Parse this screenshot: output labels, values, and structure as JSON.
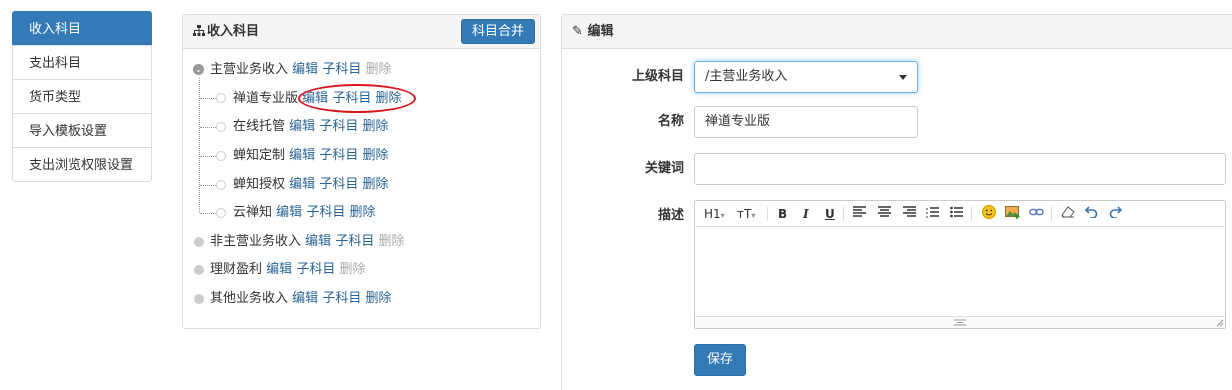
{
  "sidebar": {
    "items": [
      {
        "label": "收入科目",
        "active": true
      },
      {
        "label": "支出科目"
      },
      {
        "label": "货币类型"
      },
      {
        "label": "导入模板设置"
      },
      {
        "label": "支出浏览权限设置"
      }
    ]
  },
  "tree_panel": {
    "title": "收入科目",
    "merge_button": "科目合并",
    "nodes": [
      {
        "name": "主营业务收入",
        "edit": "编辑",
        "child": "子科目",
        "delete": "删除",
        "delete_disabled": true,
        "expanded": true,
        "children": [
          {
            "name": "禅道专业版",
            "edit": "编辑",
            "child": "子科目",
            "delete": "删除"
          },
          {
            "name": "在线托管",
            "edit": "编辑",
            "child": "子科目",
            "delete": "删除"
          },
          {
            "name": "蝉知定制",
            "edit": "编辑",
            "child": "子科目",
            "delete": "删除"
          },
          {
            "name": "蝉知授权",
            "edit": "编辑",
            "child": "子科目",
            "delete": "删除"
          },
          {
            "name": "云禅知",
            "edit": "编辑",
            "child": "子科目",
            "delete": "删除"
          }
        ]
      },
      {
        "name": "非主营业务收入",
        "edit": "编辑",
        "child": "子科目",
        "delete": "删除",
        "delete_disabled": true
      },
      {
        "name": "理财盈利",
        "edit": "编辑",
        "child": "子科目",
        "delete": "删除",
        "delete_disabled": true
      },
      {
        "name": "其他业务收入",
        "edit": "编辑",
        "child": "子科目",
        "delete": "删除"
      }
    ]
  },
  "edit_panel": {
    "title": "编辑",
    "parent_label": "上级科目",
    "parent_value": "/主营业务收入",
    "name_label": "名称",
    "name_value": "禅道专业版",
    "keyword_label": "关键词",
    "keyword_value": "",
    "desc_label": "描述",
    "toolbar": {
      "heading": "H1",
      "fontsize": "тT",
      "bold": "B",
      "italic": "I",
      "underline": "U"
    },
    "save_button": "保存"
  },
  "colors": {
    "primary": "#337ab7",
    "link": "#2a6496",
    "annotation": "#d9151e"
  }
}
